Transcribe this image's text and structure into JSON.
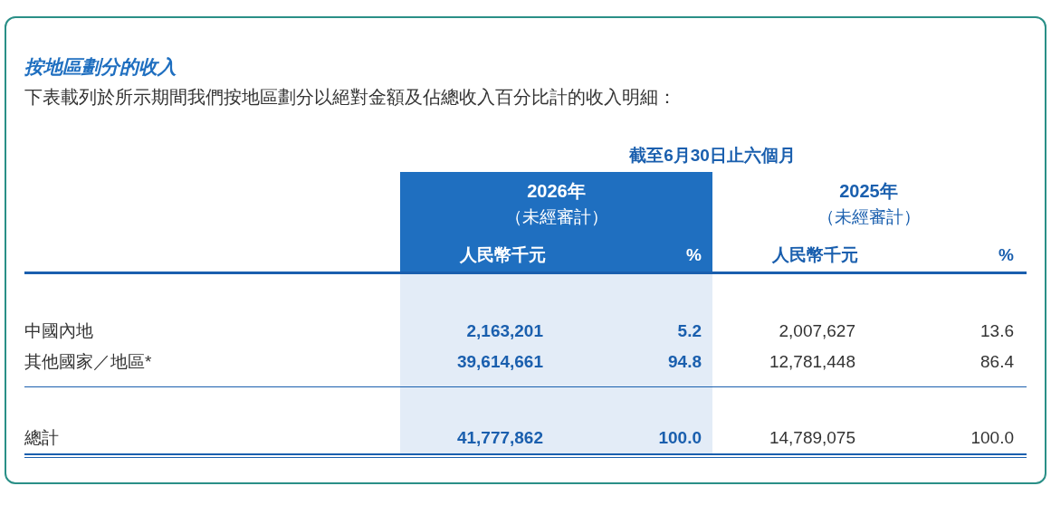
{
  "title": "按地區劃分的收入",
  "intro": "下表載列於所示期間我們按地區劃分以絕對金額及佔總收入百分比計的收入明細：",
  "table": {
    "period_label": "截至6月30日止六個月",
    "periods": [
      {
        "year": "2026年",
        "note": "（未經審計）",
        "highlighted": true,
        "columns": [
          "人民幣千元",
          "%"
        ]
      },
      {
        "year": "2025年",
        "note": "（未經審計）",
        "highlighted": false,
        "columns": [
          "人民幣千元",
          "%"
        ]
      }
    ],
    "rows": [
      {
        "label": "中國內地",
        "values": [
          "2,163,201",
          "5.2",
          "2,007,627",
          "13.6"
        ]
      },
      {
        "label": "其他國家／地區*",
        "values": [
          "39,614,661",
          "94.8",
          "12,781,448",
          "86.4"
        ]
      }
    ],
    "total": {
      "label": "總計",
      "values": [
        "41,777,862",
        "100.0",
        "14,789,075",
        "100.0"
      ]
    }
  }
}
